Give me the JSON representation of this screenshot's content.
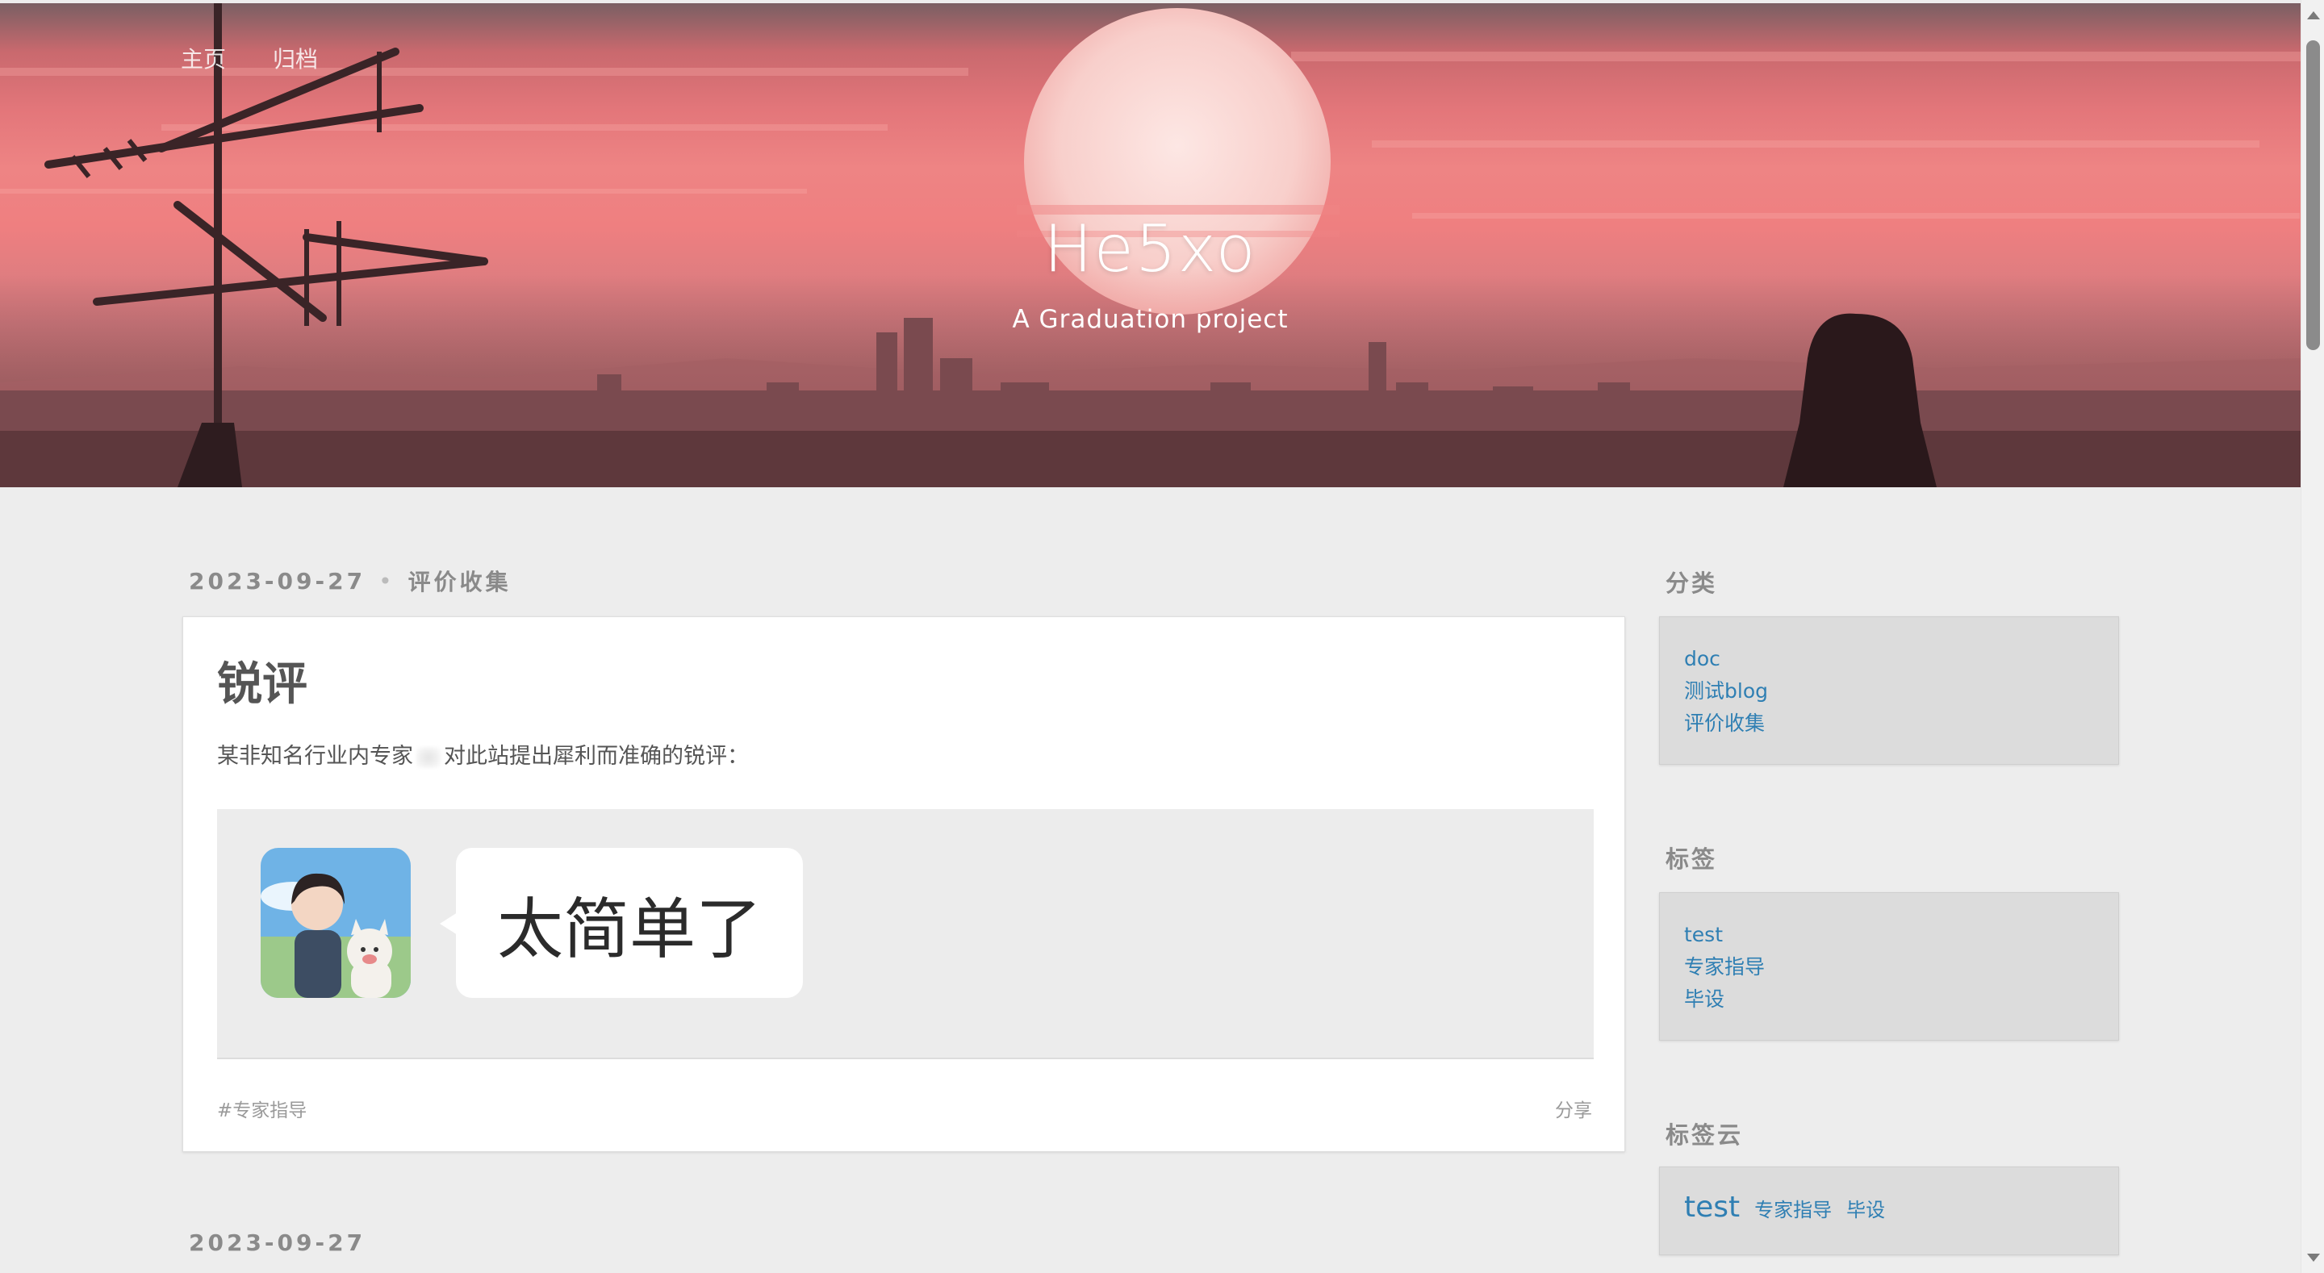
{
  "nav": {
    "items": [
      "主页",
      "归档"
    ]
  },
  "header": {
    "title": "He5xo",
    "subtitle": "A Graduation project"
  },
  "post": {
    "date": "2023-09-27",
    "category": "评价收集",
    "title": "锐评",
    "text_before": "某非知名行业内专家",
    "text_after": "对此站提出犀利而准确的锐评：",
    "bubble_text": "太简单了",
    "tag": "#专家指导",
    "share": "分享"
  },
  "next_post": {
    "date": "2023-09-27"
  },
  "sidebar": {
    "categories": {
      "title": "分类",
      "items": [
        "doc",
        "测试blog",
        "评价收集"
      ]
    },
    "tags": {
      "title": "标签",
      "items": [
        "test",
        "专家指导",
        "毕设"
      ]
    },
    "tagcloud": {
      "title": "标签云",
      "items": [
        "test",
        "专家指导",
        "毕设"
      ]
    }
  },
  "colors": {
    "link": "#2f7fb3",
    "accent_sky": "#ee8484"
  }
}
